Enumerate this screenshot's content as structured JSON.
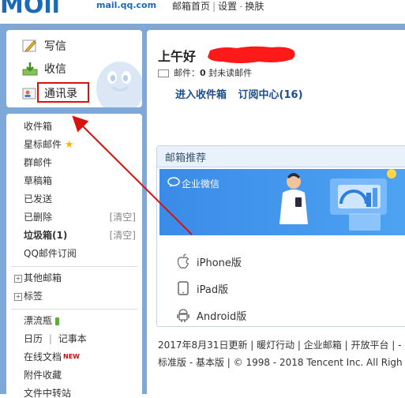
{
  "header": {
    "logo_sub": "mail.qq.com",
    "links": [
      "邮箱首页",
      "设置",
      "换肤"
    ]
  },
  "left_top": {
    "write": "写信",
    "inbox": "收信",
    "contacts": "通讯录"
  },
  "nav": {
    "inbox": "收件箱",
    "starred": "星标邮件",
    "group": "群邮件",
    "drafts": "草稿箱",
    "sent": "已发送",
    "deleted": "已删除",
    "deleted_clear": "[清空]",
    "spam": "垃圾箱(1)",
    "spam_clear": "[清空]",
    "subscribe": "QQ邮件订阅",
    "other_mailboxes": "其他邮箱",
    "tags": "标签",
    "bottle": "漂流瓶",
    "calendar": "日历",
    "notepad": "记事本",
    "docs": "在线文档",
    "docs_badge": "NEW",
    "attachments": "附件收藏",
    "file_transfer": "文件中转站"
  },
  "main": {
    "greeting": "上午好",
    "mail_info_prefix": "邮件：",
    "unread_count": "0",
    "mail_info_suffix": "封未读邮件",
    "link_inbox": "进入收件箱",
    "link_subscribe": "订阅中心(16)"
  },
  "recommend": {
    "title": "邮箱推荐",
    "banner_title": "企业微信",
    "apps": [
      "iPhone版",
      "iPad版",
      "Android版"
    ]
  },
  "footer": {
    "line1": "2017年8月31日更新 | 暖灯行动 | 企业邮箱 | 开放平台 | -",
    "line2": "标准版 - 基本版 | © 1998 - 2018 Tencent Inc. All Righ"
  },
  "colors": {
    "background": "#7ea8d8",
    "highlight": "#d8120c",
    "link": "#1c4d8e"
  }
}
